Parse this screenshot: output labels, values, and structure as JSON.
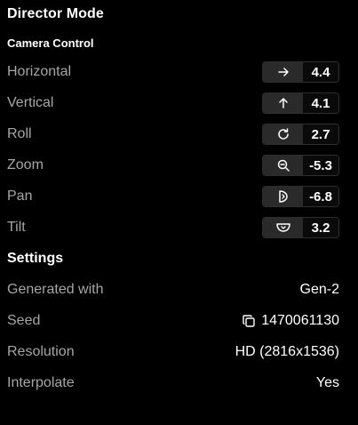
{
  "panel": {
    "title": "Director Mode",
    "subtitle": "Camera Control"
  },
  "camera": [
    {
      "label": "Horizontal",
      "icon": "arrow-right-icon",
      "value": "4.4"
    },
    {
      "label": "Vertical",
      "icon": "arrow-up-icon",
      "value": "4.1"
    },
    {
      "label": "Roll",
      "icon": "rotate-icon",
      "value": "2.7"
    },
    {
      "label": "Zoom",
      "icon": "zoom-out-icon",
      "value": "-5.3"
    },
    {
      "label": "Pan",
      "icon": "pan-icon",
      "value": "-6.8"
    },
    {
      "label": "Tilt",
      "icon": "tilt-icon",
      "value": "3.2"
    }
  ],
  "settings": {
    "title": "Settings",
    "generated_with": {
      "label": "Generated with",
      "value": "Gen-2"
    },
    "seed": {
      "label": "Seed",
      "value": "1470061130",
      "icon": "copy-icon"
    },
    "resolution": {
      "label": "Resolution",
      "value": "HD (2816x1536)"
    },
    "interpolate": {
      "label": "Interpolate",
      "value": "Yes"
    }
  }
}
